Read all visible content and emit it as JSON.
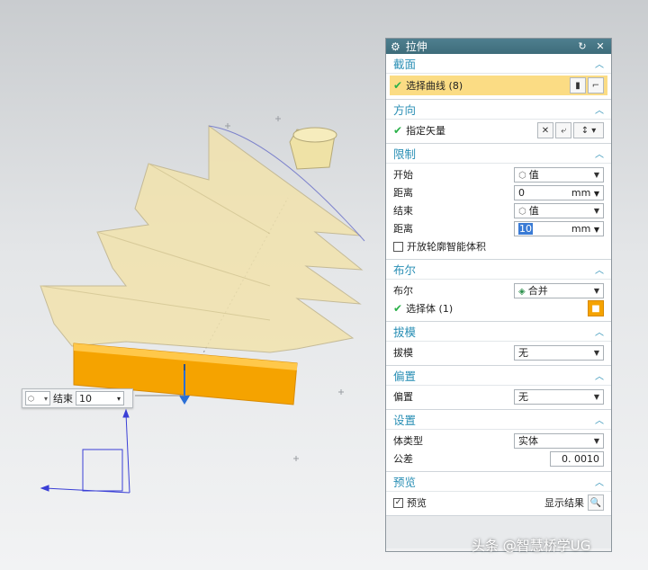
{
  "dialog": {
    "title": "拉伸",
    "sections": {
      "section_curve": {
        "title": "截面",
        "select_curve": "选择曲线 (8)"
      },
      "direction": {
        "title": "方向",
        "specify_vector": "指定矢量"
      },
      "limits": {
        "title": "限制",
        "start_label": "开始",
        "start_value": "值",
        "distance1_label": "距离",
        "distance1_value": "0",
        "distance1_unit": "mm",
        "end_label": "结束",
        "end_value": "值",
        "distance2_label": "距离",
        "distance2_value": "10",
        "distance2_unit": "mm",
        "open_profile": "开放轮廓智能体积"
      },
      "boolean": {
        "title": "布尔",
        "boolean_label": "布尔",
        "boolean_value": "合并",
        "select_body": "选择体 (1)"
      },
      "draft": {
        "title": "拔模",
        "draft_label": "拔模",
        "draft_value": "无"
      },
      "offset": {
        "title": "偏置",
        "offset_label": "偏置",
        "offset_value": "无"
      },
      "settings": {
        "title": "设置",
        "body_type_label": "体类型",
        "body_type_value": "实体",
        "tolerance_label": "公差",
        "tolerance_value": "0. 0010"
      },
      "preview": {
        "title": "预览",
        "preview_label": "预览",
        "show_result": "显示结果"
      }
    }
  },
  "float_control": {
    "label": "结束",
    "value": "10"
  },
  "watermark": "头条 @智慧桥学UG",
  "colors": {
    "section_title": "#2a8fb5",
    "highlight_row": "#fbdc84",
    "model_body": "#f2e3ad",
    "extrude_solid": "#f5a300",
    "titlebar": "#3e6c7a"
  }
}
